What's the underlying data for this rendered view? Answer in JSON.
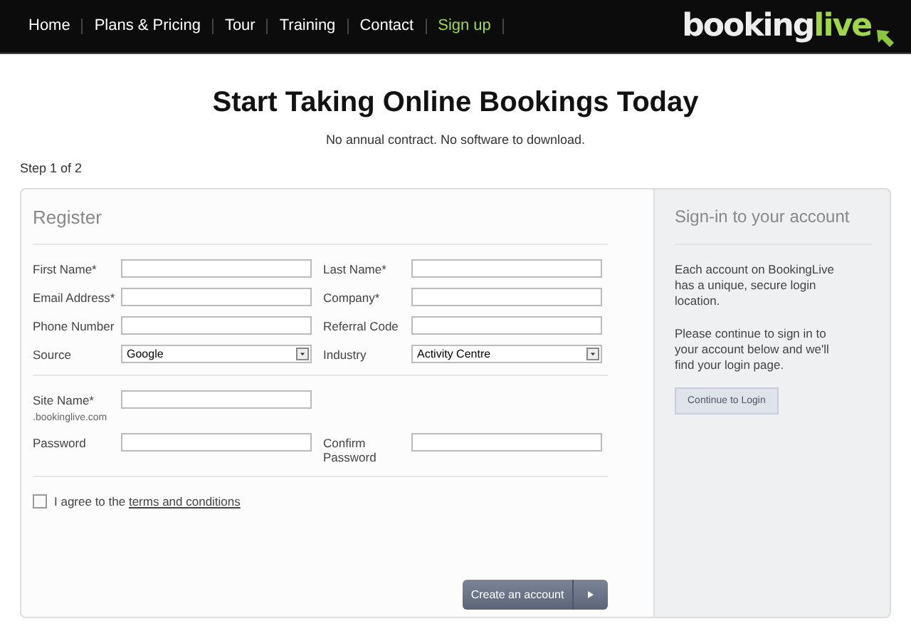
{
  "nav": {
    "items": [
      {
        "label": "Home",
        "selected": false
      },
      {
        "label": "Plans & Pricing",
        "selected": false
      },
      {
        "label": "Tour",
        "selected": false
      },
      {
        "label": "Training",
        "selected": false
      },
      {
        "label": "Contact",
        "selected": false
      },
      {
        "label": "Sign up",
        "selected": true
      }
    ],
    "logo": {
      "part_1": "booking",
      "part_2": "live"
    }
  },
  "heading": "Start Taking Online Bookings Today",
  "subheading": "No annual contract. No software to download.",
  "step": "Step 1 of 2",
  "register": {
    "title": "Register",
    "sections": [
      {
        "rows": [
          [
            {
              "label": "First Name*",
              "kind": "text"
            },
            {
              "label": "Last Name*",
              "kind": "text"
            }
          ],
          [
            {
              "label": "Email Address*",
              "kind": "text"
            },
            {
              "label": "Company*",
              "kind": "text"
            }
          ],
          [
            {
              "label": "Phone Number",
              "kind": "text"
            },
            {
              "label": "Referral Code",
              "kind": "text"
            }
          ],
          [
            {
              "label": "Source",
              "kind": "select",
              "value": "Google"
            },
            {
              "label": "Industry",
              "kind": "select",
              "value": "Activity Centre"
            }
          ]
        ]
      },
      {
        "rows": [
          [
            {
              "label": "Site Name*",
              "note": ".bookinglive.com",
              "kind": "text"
            }
          ],
          [
            {
              "label": "Password",
              "kind": "password"
            },
            {
              "label": "Confirm Password",
              "kind": "password"
            }
          ]
        ]
      }
    ],
    "agree": {
      "checked": false,
      "text": "I agree to the ",
      "link": "terms and conditions"
    },
    "submit": "Create an account"
  },
  "signin": {
    "title": "Sign-in to your account",
    "paragraphs": [
      "Each account on BookingLive has a unique, secure login location.",
      "Please continue to sign in to your account below and we'll find your login page."
    ],
    "button": "Continue to Login"
  }
}
